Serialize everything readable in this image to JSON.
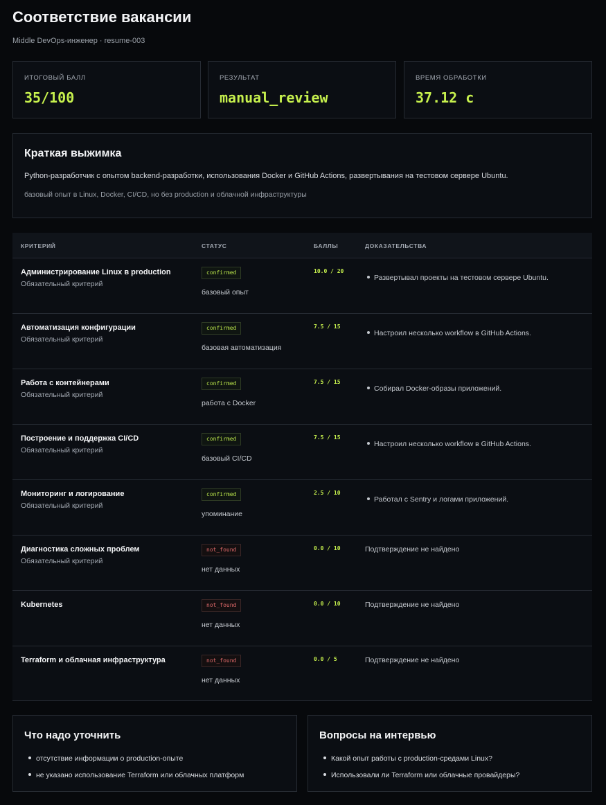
{
  "header": {
    "title": "Соответствие вакансии",
    "subtitle": "Middle DevOps-инженер · resume-003"
  },
  "stats": [
    {
      "label": "ИТОГОВЫЙ БАЛЛ",
      "value": "35/100"
    },
    {
      "label": "РЕЗУЛЬТАТ",
      "value": "manual_review"
    },
    {
      "label": "ВРЕМЯ ОБРАБОТКИ",
      "value": "37.12 с"
    }
  ],
  "summary": {
    "title": "Краткая выжимка",
    "text": "Python-разработчик с опытом backend-разработки, использования Docker и GitHub Actions, развертывания на тестовом сервере Ubuntu.",
    "note": "базовый опыт в Linux, Docker, CI/CD, но без production и облачной инфраструктуры"
  },
  "table": {
    "headers": [
      "КРИТЕРИЙ",
      "СТАТУС",
      "БАЛЛЫ",
      "ДОКАЗАТЕЛЬСТВА"
    ],
    "rows": [
      {
        "name": "Администрирование Linux в production",
        "req": "Обязательный критерий",
        "status": "confirmed",
        "note": "базовый опыт",
        "score": "10.0 / 20",
        "evidence": "Развертывал проекты на тестовом сервере Ubuntu."
      },
      {
        "name": "Автоматизация конфигурации",
        "req": "Обязательный критерий",
        "status": "confirmed",
        "note": "базовая автоматизация",
        "score": "7.5 / 15",
        "evidence": "Настроил несколько workflow в GitHub Actions."
      },
      {
        "name": "Работа с контейнерами",
        "req": "Обязательный критерий",
        "status": "confirmed",
        "note": "работа с Docker",
        "score": "7.5 / 15",
        "evidence": "Собирал Docker-образы приложений."
      },
      {
        "name": "Построение и поддержка CI/CD",
        "req": "Обязательный критерий",
        "status": "confirmed",
        "note": "базовый CI/CD",
        "score": "7.5 / 15",
        "evidence": "Настроил несколько workflow в GitHub Actions."
      },
      {
        "name": "Мониторинг и логирование",
        "req": "Обязательный критерий",
        "status": "confirmed",
        "note": "упоминание",
        "score": "2.5 / 10",
        "evidence": "Работал с Sentry и логами приложений."
      },
      {
        "name": "Диагностика сложных проблем",
        "req": "Обязательный критерий",
        "status": "not_found",
        "note": "нет данных",
        "score": "0.0 / 10",
        "evidence": "Подтверждение не найдено"
      },
      {
        "name": "Kubernetes",
        "req": "",
        "status": "not_found",
        "note": "нет данных",
        "score": "0.0 / 10",
        "evidence": "Подтверждение не найдено"
      },
      {
        "name": "Terraform и облачная инфраструктура",
        "req": "",
        "status": "not_found",
        "note": "нет данных",
        "score": "0.0 / 5",
        "evidence": "Подтверждение не найдено"
      }
    ]
  },
  "clarify": {
    "title": "Что надо уточнить",
    "items": [
      "отсутствие информации о production-опыте",
      "не указано использование Terraform или облачных платформ"
    ]
  },
  "questions": {
    "title": "Вопросы на интервью",
    "items": [
      "Какой опыт работы с production-средами Linux?",
      "Использовали ли Terraform или облачные провайдеры?"
    ]
  },
  "colors": {
    "accent": "#c6f04d",
    "confirmed": "#b8e34a",
    "not_found": "#e06a6a",
    "background": "#07090c",
    "card": "#0b0e13"
  }
}
